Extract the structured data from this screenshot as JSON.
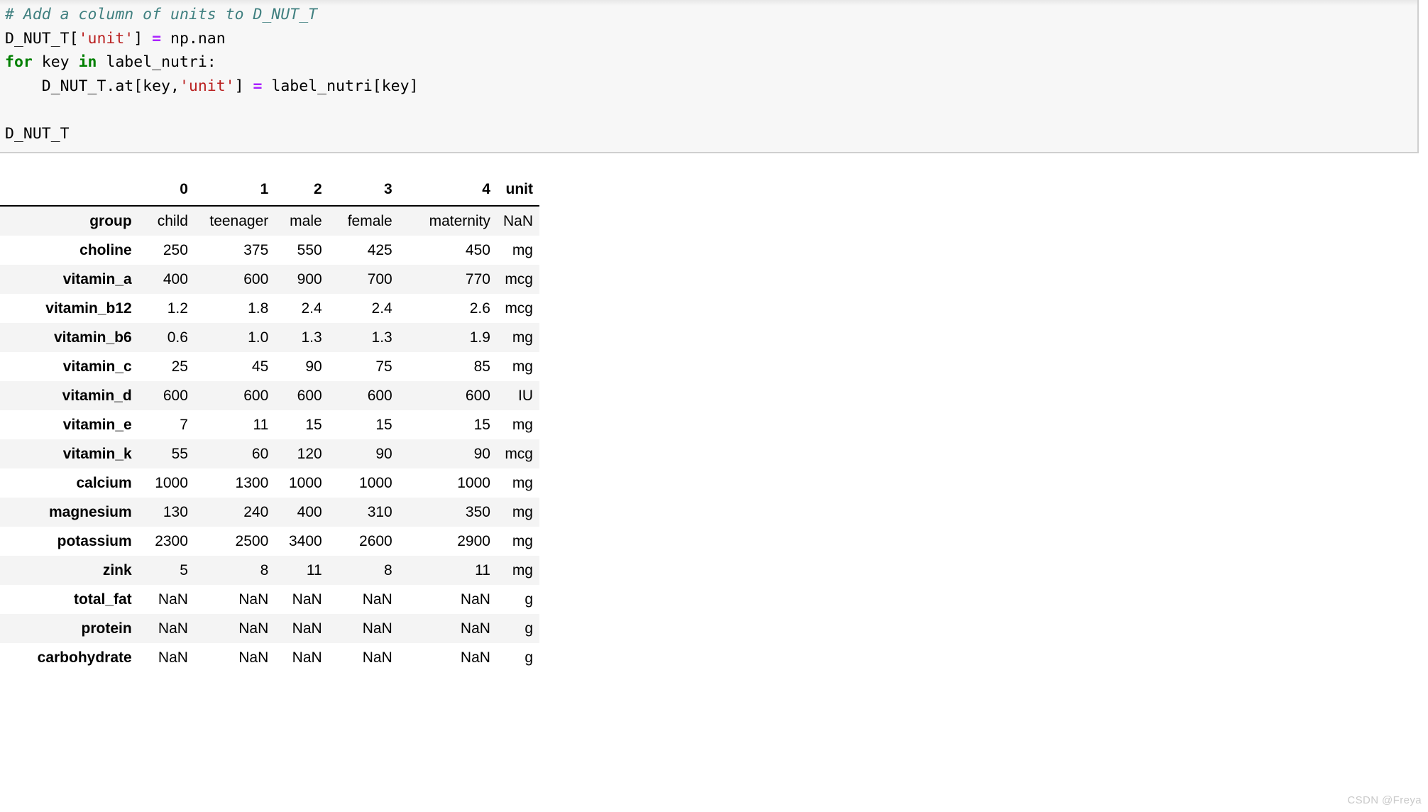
{
  "notebook": {
    "code_cell": {
      "background": "#f7f7f7",
      "lines": [
        [
          {
            "t": "comment",
            "s": "# Add a column of units to D_NUT_T"
          }
        ],
        [
          {
            "t": "plain",
            "s": "D_NUT_T["
          },
          {
            "t": "string",
            "s": "'unit'"
          },
          {
            "t": "plain",
            "s": "] "
          },
          {
            "t": "op",
            "s": "="
          },
          {
            "t": "plain",
            "s": " np.nan"
          }
        ],
        [
          {
            "t": "keyword",
            "s": "for"
          },
          {
            "t": "plain",
            "s": " key "
          },
          {
            "t": "keyword",
            "s": "in"
          },
          {
            "t": "plain",
            "s": " label_nutri:"
          }
        ],
        [
          {
            "t": "plain",
            "s": "    D_NUT_T.at[key,"
          },
          {
            "t": "string",
            "s": "'unit'"
          },
          {
            "t": "plain",
            "s": "] "
          },
          {
            "t": "op",
            "s": "="
          },
          {
            "t": "plain",
            "s": " label_nutri[key]"
          }
        ],
        [
          {
            "t": "plain",
            "s": ""
          }
        ],
        [
          {
            "t": "plain",
            "s": "D_NUT_T"
          }
        ]
      ],
      "colors": {
        "comment": "#408080",
        "keyword": "#008000",
        "string": "#ba2121",
        "operator": "#aa22ff",
        "plain": "#000000"
      }
    }
  },
  "dataframe": {
    "name": "D_NUT_T",
    "columns": [
      "0",
      "1",
      "2",
      "3",
      "4",
      "unit"
    ],
    "index_header": "",
    "rows": [
      {
        "index": "group",
        "values": [
          "child",
          "teenager",
          "male",
          "female",
          "maternity",
          "NaN"
        ]
      },
      {
        "index": "choline",
        "values": [
          "250",
          "375",
          "550",
          "425",
          "450",
          "mg"
        ]
      },
      {
        "index": "vitamin_a",
        "values": [
          "400",
          "600",
          "900",
          "700",
          "770",
          "mcg"
        ]
      },
      {
        "index": "vitamin_b12",
        "values": [
          "1.2",
          "1.8",
          "2.4",
          "2.4",
          "2.6",
          "mcg"
        ]
      },
      {
        "index": "vitamin_b6",
        "values": [
          "0.6",
          "1.0",
          "1.3",
          "1.3",
          "1.9",
          "mg"
        ]
      },
      {
        "index": "vitamin_c",
        "values": [
          "25",
          "45",
          "90",
          "75",
          "85",
          "mg"
        ]
      },
      {
        "index": "vitamin_d",
        "values": [
          "600",
          "600",
          "600",
          "600",
          "600",
          "IU"
        ]
      },
      {
        "index": "vitamin_e",
        "values": [
          "7",
          "11",
          "15",
          "15",
          "15",
          "mg"
        ]
      },
      {
        "index": "vitamin_k",
        "values": [
          "55",
          "60",
          "120",
          "90",
          "90",
          "mcg"
        ]
      },
      {
        "index": "calcium",
        "values": [
          "1000",
          "1300",
          "1000",
          "1000",
          "1000",
          "mg"
        ]
      },
      {
        "index": "magnesium",
        "values": [
          "130",
          "240",
          "400",
          "310",
          "350",
          "mg"
        ]
      },
      {
        "index": "potassium",
        "values": [
          "2300",
          "2500",
          "3400",
          "2600",
          "2900",
          "mg"
        ]
      },
      {
        "index": "zink",
        "values": [
          "5",
          "8",
          "11",
          "8",
          "11",
          "mg"
        ]
      },
      {
        "index": "total_fat",
        "values": [
          "NaN",
          "NaN",
          "NaN",
          "NaN",
          "NaN",
          "g"
        ]
      },
      {
        "index": "protein",
        "values": [
          "NaN",
          "NaN",
          "NaN",
          "NaN",
          "NaN",
          "g"
        ]
      },
      {
        "index": "carbohydrate",
        "values": [
          "NaN",
          "NaN",
          "NaN",
          "NaN",
          "NaN",
          "g"
        ]
      }
    ]
  },
  "watermark": {
    "text": "CSDN @Freya",
    "color": "#c9c9c9"
  }
}
